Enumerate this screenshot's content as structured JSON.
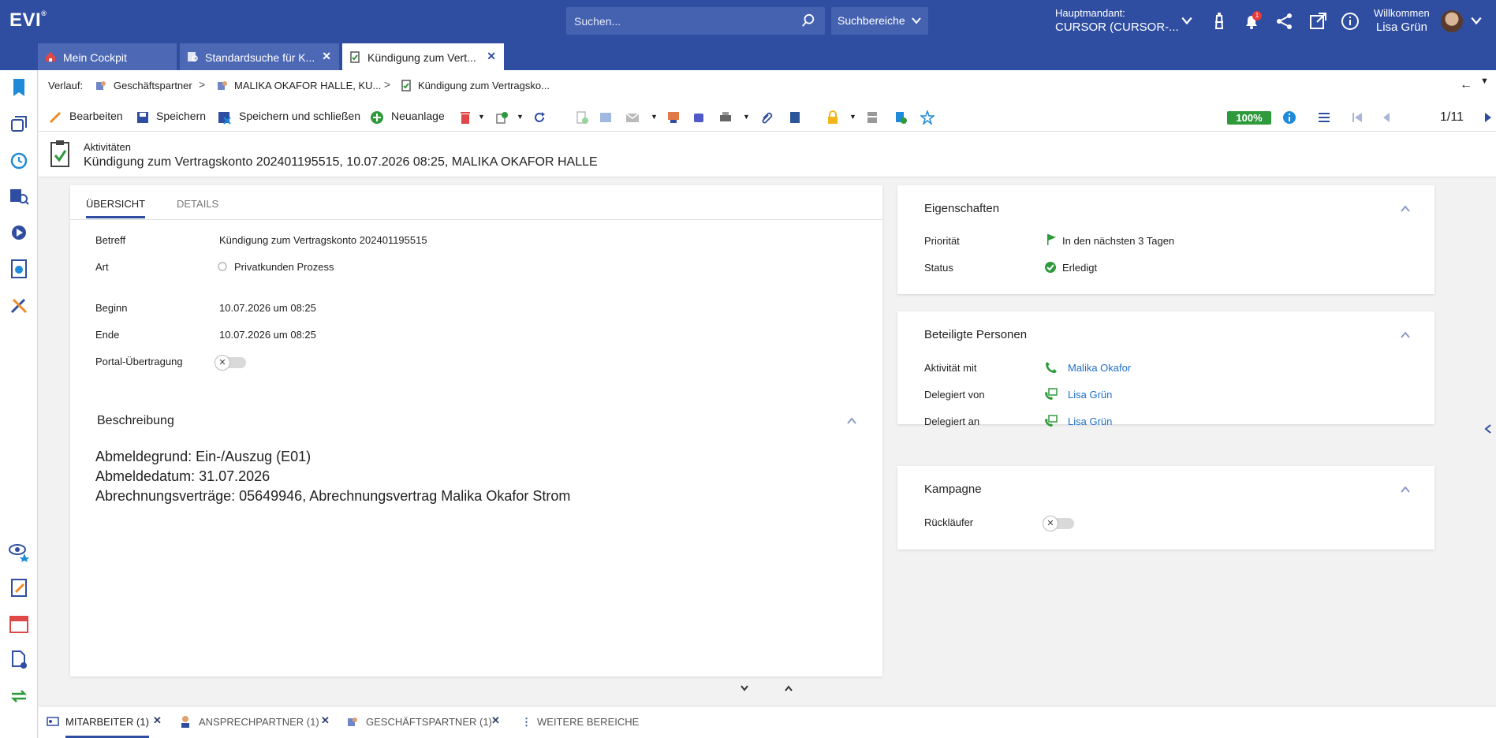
{
  "header": {
    "logo": "EVI",
    "logo_mark": "®",
    "search_placeholder": "Suchen...",
    "search_area": "Suchbereiche",
    "tenant_label": "Hauptmandant:",
    "tenant_value": "CURSOR (CURSOR-...",
    "notification_count": "1",
    "welcome": "Willkommen",
    "user_name": "Lisa Grün"
  },
  "tabs": [
    {
      "label": "Mein Cockpit"
    },
    {
      "label": "Standardsuche für K..."
    },
    {
      "label": "Kündigung zum Vert..."
    }
  ],
  "breadcrumb": {
    "label": "Verlauf:",
    "items": [
      "Geschäftspartner",
      "MALIKA OKAFOR HALLE, KU...",
      "Kündigung zum Vertragsko..."
    ]
  },
  "toolbar": {
    "edit": "Bearbeiten",
    "save": "Speichern",
    "save_close": "Speichern und schließen",
    "new": "Neuanlage",
    "completion": "100%",
    "pager": "1/11"
  },
  "record": {
    "category": "Aktivitäten",
    "title": "Kündigung zum Vertragskonto 202401195515, 10.07.2026 08:25, MALIKA OKAFOR HALLE"
  },
  "main": {
    "tabs": [
      "ÜBERSICHT",
      "DETAILS"
    ],
    "fields": {
      "betreff_label": "Betreff",
      "betreff_value": "Kündigung zum Vertragskonto 202401195515",
      "art_label": "Art",
      "art_value": "Privatkunden Prozess",
      "beginn_label": "Beginn",
      "beginn_value": "10.07.2026 um 08:25",
      "ende_label": "Ende",
      "ende_value": "10.07.2026 um 08:25",
      "portal_label": "Portal-Übertragung"
    },
    "description": {
      "title": "Beschreibung",
      "lines": [
        "Abmeldegrund: Ein-/Auszug (E01)",
        "Abmeldedatum: 31.07.2026",
        "Abrechnungsverträge: 05649946, Abrechnungsvertrag Malika Okafor Strom"
      ]
    }
  },
  "properties": {
    "title": "Eigenschaften",
    "priority_label": "Priorität",
    "priority_value": "In den nächsten 3 Tagen",
    "status_label": "Status",
    "status_value": "Erledigt"
  },
  "persons": {
    "title": "Beteiligte Personen",
    "rows": [
      {
        "label": "Aktivität mit",
        "value": "Malika Okafor"
      },
      {
        "label": "Delegiert von",
        "value": "Lisa Grün"
      },
      {
        "label": "Delegiert an",
        "value": "Lisa Grün"
      }
    ]
  },
  "campaign": {
    "title": "Kampagne",
    "returns_label": "Rückläufer"
  },
  "bottom_tabs": [
    {
      "label": "MITARBEITER (1)"
    },
    {
      "label": "ANSPRECHPARTNER (1)"
    },
    {
      "label": "GESCHÄFTSPARTNER (1)"
    },
    {
      "label": "WEITERE BEREICHE"
    }
  ],
  "colors": {
    "brand": "#2f4ea1",
    "link": "#1f6fc7",
    "success": "#2e9a3c"
  }
}
